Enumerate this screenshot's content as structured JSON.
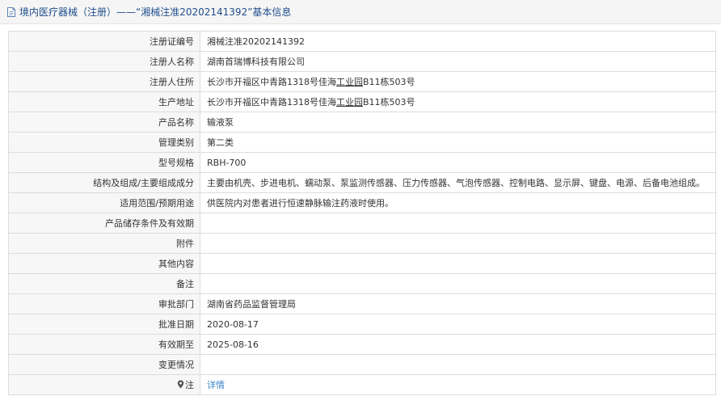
{
  "header": {
    "title": "境内医疗器械（注册）——“湘械注准20202141392”基本信息"
  },
  "rows": [
    {
      "label": "注册证编号",
      "value": "湘械注准20202141392"
    },
    {
      "label": "注册人名称",
      "value": "湖南首瑞博科技有限公司"
    },
    {
      "label": "注册人住所",
      "value_pre": "长沙市开福区中青路1318号佳海",
      "value_u": "工业园",
      "value_post": "B11栋503号"
    },
    {
      "label": "生产地址",
      "value_pre": "长沙市开福区中青路1318号佳海",
      "value_u": "工业园",
      "value_post": "B11栋503号"
    },
    {
      "label": "产品名称",
      "value": "输液泵"
    },
    {
      "label": "管理类别",
      "value": "第二类"
    },
    {
      "label": "型号规格",
      "value": "RBH-700"
    },
    {
      "label": "结构及组成/主要组成成分",
      "value": "主要由机壳、步进电机、蠕动泵、泵监测传感器、压力传感器、气泡传感器、控制电路、显示屏、键盘、电源、后备电池组成。"
    },
    {
      "label": "适用范围/预期用途",
      "value": "供医院内对患者进行恒速静脉输注药液时使用。"
    },
    {
      "label": "产品储存条件及有效期",
      "value": ""
    },
    {
      "label": "附件",
      "value": ""
    },
    {
      "label": "其他内容",
      "value": ""
    },
    {
      "label": "备注",
      "value": ""
    },
    {
      "label": "审批部门",
      "value": "湖南省药品监督管理局"
    },
    {
      "label": "批准日期",
      "value": "2020-08-17"
    },
    {
      "label": "有效期至",
      "value": "2025-08-16"
    },
    {
      "label": "变更情况",
      "value": ""
    },
    {
      "label": "注",
      "value": "详情"
    }
  ],
  "colors": {
    "title_text": "#1f4e8c",
    "link": "#3a86c8",
    "label_bg": "#f7f7f7",
    "border": "#dcdcdc"
  },
  "icons": {
    "title": "document-icon",
    "note": "pin-icon"
  }
}
